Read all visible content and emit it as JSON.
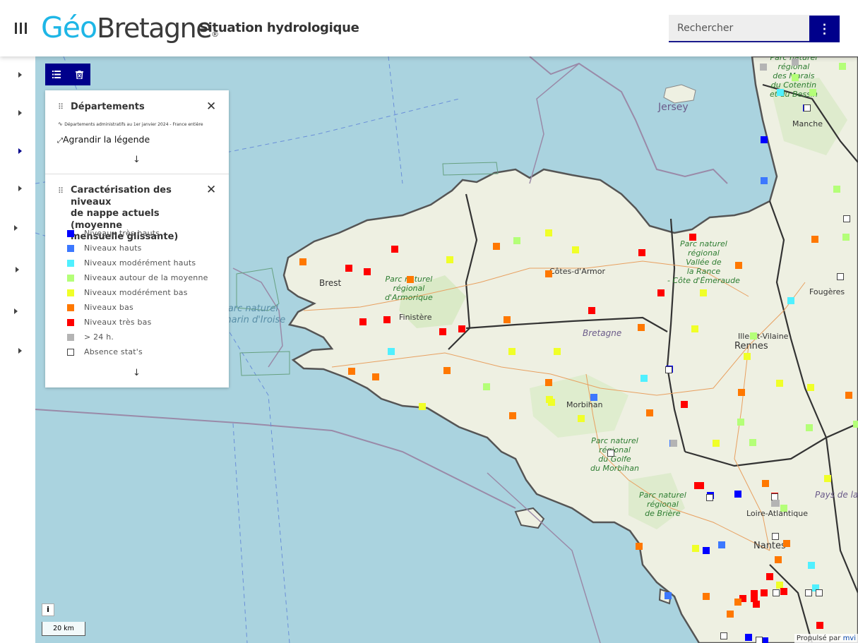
{
  "header": {
    "logo_main": "Géo",
    "logo_second": "Bretagne",
    "logo_mark": "®",
    "title": "Situation hydrologique",
    "search_placeholder": "Rechercher",
    "more_icon": "⋮"
  },
  "toolbar": {
    "list_icon": "☰",
    "trash_icon": "🗑"
  },
  "legend": {
    "layer1": {
      "title": "Départements",
      "subtitle": "Départements administratifs au 1er janvier 2024 - France entière",
      "expand_label": "Agrandir la légende"
    },
    "layer2": {
      "title_lines": [
        "Caractérisation des niveaux",
        "de nappe actuels (moyenne",
        "mensuelle glissante)"
      ],
      "items": [
        {
          "label": "Niveaux très hauts",
          "color": "#0000ff"
        },
        {
          "label": "Niveaux hauts",
          "color": "#3c78ff"
        },
        {
          "label": "Niveaux modérément hauts",
          "color": "#50f0ff"
        },
        {
          "label": "Niveaux autour de la moyenne",
          "color": "#b4ff78"
        },
        {
          "label": "Niveaux modérément bas",
          "color": "#f0ff28"
        },
        {
          "label": "Niveaux bas",
          "color": "#ff7800"
        },
        {
          "label": "Niveaux très bas",
          "color": "#ff0000"
        },
        {
          "label": "> 24 h.",
          "color": "#b4b4b4"
        },
        {
          "label": "Absence stat's",
          "color": "#ffffff"
        }
      ]
    }
  },
  "map": {
    "sea_labels": [
      "Parc naturel",
      "marin d'Iroise"
    ],
    "island_labels": [
      "Jersey"
    ],
    "park_labels": [
      [
        "Parc naturel",
        "régional",
        "d'Armorique"
      ],
      [
        "Parc naturel",
        "régional",
        "Vallée de",
        "la Rance",
        "- Côte d'Émeraude"
      ],
      [
        "Parc naturel",
        "régional",
        "du Golfe",
        "du Morbihan"
      ],
      [
        "Parc naturel",
        "régional",
        "de Brière"
      ],
      [
        "Parc naturel",
        "régional",
        "des Marais",
        "du Cotentin",
        "et du Bessin"
      ]
    ],
    "dept_labels": [
      "Côtes-d'Armor",
      "Finistère",
      "Morbihan",
      "Ille-et-Vilaine",
      "Loire-Atlantique",
      "Manche"
    ],
    "region_labels": [
      "Bretagne",
      "Pays de la Loire"
    ],
    "city_labels": [
      "Brest",
      "Rennes",
      "Nantes",
      "Fougères"
    ],
    "info_label": "i",
    "scale_label": "20 km",
    "attribution_prefix": "Propulsé par",
    "attribution_link": "mvi"
  }
}
